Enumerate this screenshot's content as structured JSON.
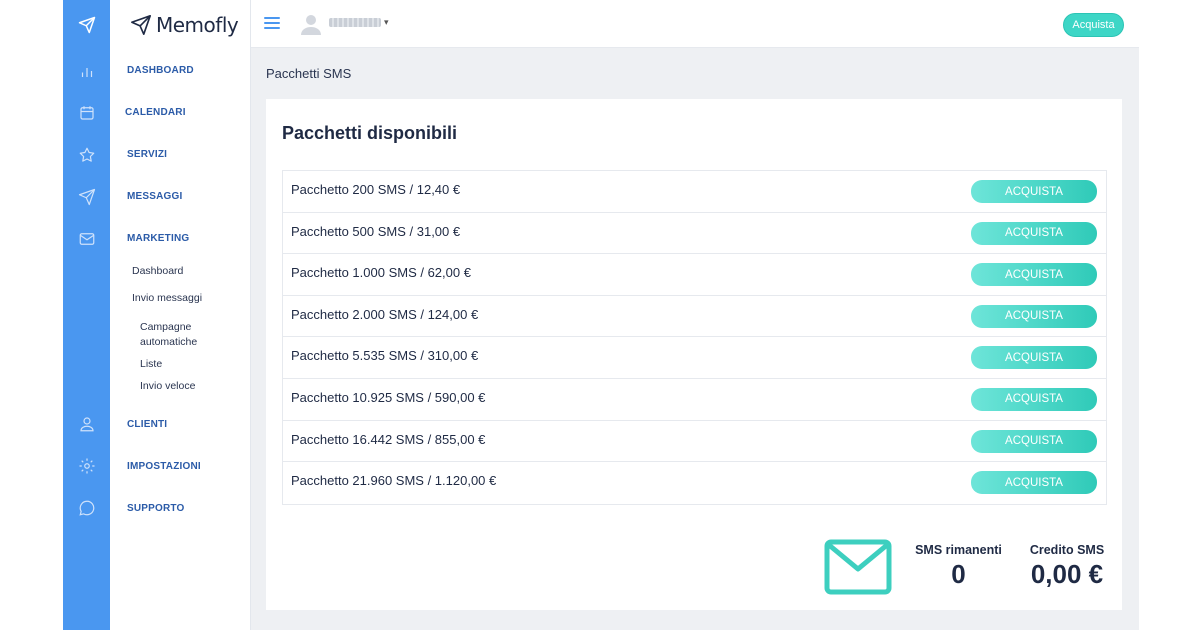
{
  "app": {
    "brand": "Memofly"
  },
  "sidebar": {
    "items": [
      {
        "label": "DASHBOARD",
        "icon": "bar-chart-icon"
      },
      {
        "label": "CALENDARI",
        "icon": "calendar-icon"
      },
      {
        "label": "SERVIZI",
        "icon": "star-icon"
      },
      {
        "label": "MESSAGGI",
        "icon": "send-icon"
      },
      {
        "label": "MARKETING",
        "icon": "mail-icon"
      },
      {
        "label": "CLIENTI",
        "icon": "user-icon"
      },
      {
        "label": "IMPOSTAZIONI",
        "icon": "gear-icon"
      },
      {
        "label": "SUPPORTO",
        "icon": "chat-icon"
      }
    ],
    "marketing_sub": {
      "dashboard": "Dashboard",
      "invio_messaggi": "Invio messaggi",
      "campagne": "Campagne automatiche",
      "liste": "Liste",
      "invio_veloce": "Invio veloce"
    }
  },
  "topbar": {
    "buy_label": "Acquista"
  },
  "main": {
    "page_title": "Pacchetti SMS",
    "card_title": "Pacchetti disponibili",
    "buy_button_label": "ACQUISTA",
    "packages": [
      "Pacchetto 200 SMS / 12,40 €",
      "Pacchetto 500 SMS / 31,00 €",
      "Pacchetto 1.000 SMS / 62,00 €",
      "Pacchetto 2.000 SMS / 124,00 €",
      "Pacchetto 5.535 SMS / 310,00 €",
      "Pacchetto 10.925 SMS / 590,00 €",
      "Pacchetto 16.442 SMS / 855,00 €",
      "Pacchetto 21.960 SMS / 1.120,00 €"
    ],
    "stats": {
      "sms_label": "SMS rimanenti",
      "sms_value": "0",
      "credit_label": "Credito SMS",
      "credit_value": "0,00 €"
    }
  },
  "colors": {
    "rail": "#4a97f0",
    "accent_teal": "#3dd6c6",
    "nav_text": "#2b5ba8",
    "heading": "#1f2a44"
  }
}
